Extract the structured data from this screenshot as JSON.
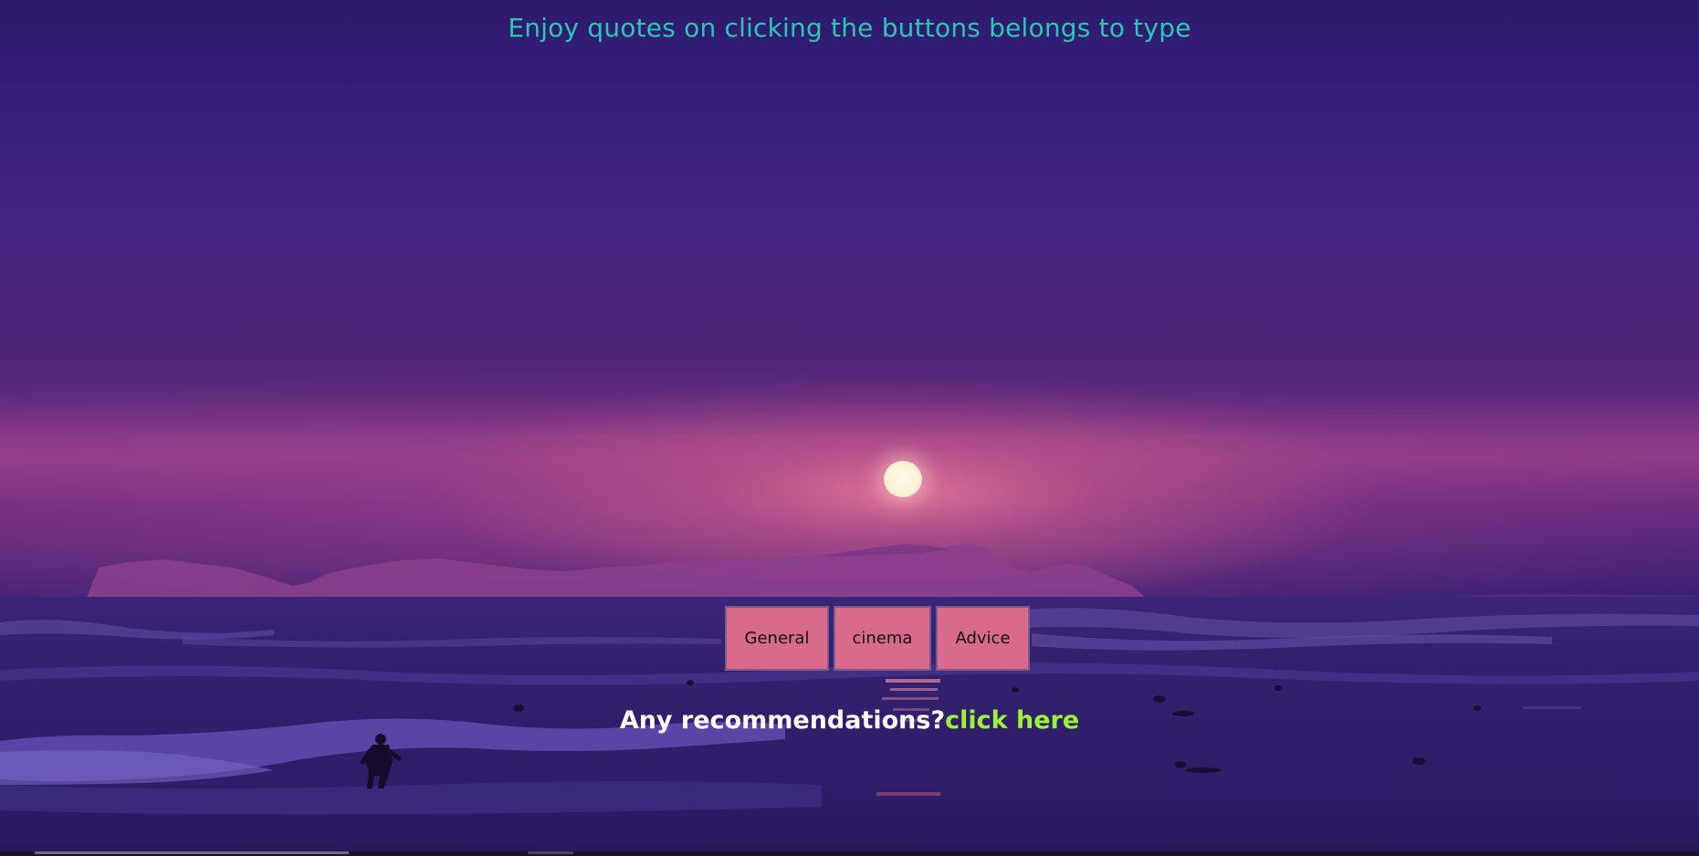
{
  "header": {
    "headline": "Enjoy quotes on clicking the buttons belongs to type"
  },
  "buttons": [
    {
      "label": "General"
    },
    {
      "label": "cinema"
    },
    {
      "label": "Advice"
    }
  ],
  "recommendation": {
    "prompt": "Any recommendations?",
    "link_label": "click here"
  },
  "colors": {
    "headline": "#2dc6b4",
    "button_bg": "#d86a8c",
    "link": "#9ff23a",
    "prompt": "#ffffff"
  }
}
